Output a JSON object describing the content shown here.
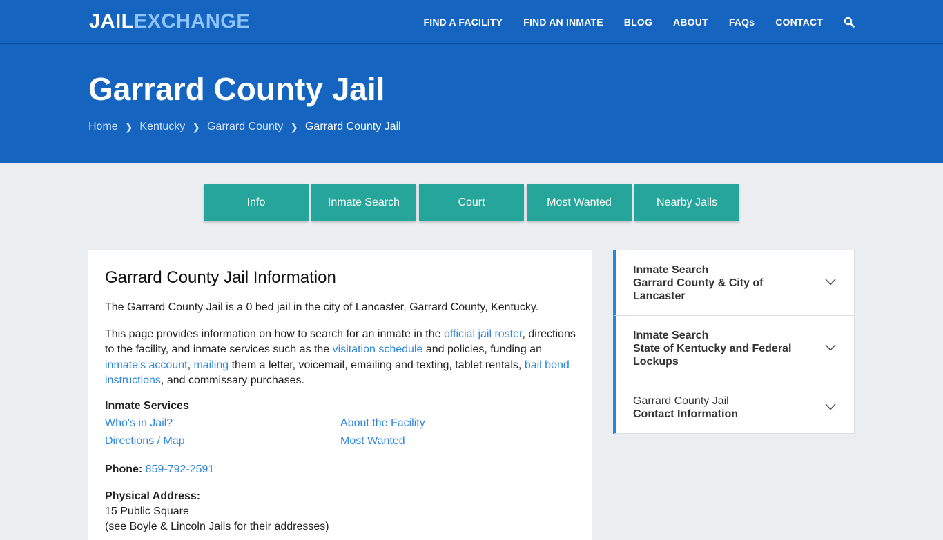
{
  "logo": {
    "part1": "JAIL",
    "part2": "EXCHANGE"
  },
  "nav": {
    "items": [
      "FIND A FACILITY",
      "FIND AN INMATE",
      "BLOG",
      "ABOUT",
      "FAQs",
      "CONTACT"
    ],
    "search_icon": "search-icon"
  },
  "hero": {
    "title": "Garrard County Jail",
    "breadcrumb": [
      "Home",
      "Kentucky",
      "Garrard County",
      "Garrard County Jail"
    ]
  },
  "tabs": [
    "Info",
    "Inmate Search",
    "Court",
    "Most Wanted",
    "Nearby Jails"
  ],
  "main": {
    "heading": "Garrard County Jail Information",
    "intro": "The Garrard County Jail is a 0 bed jail in the city of Lancaster, Garrard County, Kentucky.",
    "para2": {
      "t1": "This page provides information on how to search for an inmate in the ",
      "l1": "official jail roster",
      "t2": ", directions to the facility, and inmate services such as the ",
      "l2": "visitation schedule",
      "t3": " and policies, funding an ",
      "l3": "inmate's account",
      "t4": ", ",
      "l4": "mailing",
      "t5": " them a letter, voicemail, emailing and texting, tablet rentals, ",
      "l5": "bail bond instructions",
      "t6": ", and commissary purchases."
    },
    "services_title": "Inmate Services",
    "services": [
      "Who's in Jail?",
      "About the Facility",
      "Directions / Map",
      "Most Wanted"
    ],
    "phone_label": "Phone:",
    "phone": "859-792-2591",
    "address_label": "Physical Address:",
    "address_line1": "15 Public Square",
    "address_line2": "(see Boyle & Lincoln Jails for their addresses)"
  },
  "sidebar": [
    {
      "line1": "Inmate Search",
      "line2": "Garrard County & City of Lancaster"
    },
    {
      "line1": "Inmate Search",
      "line2": "State of Kentucky and Federal Lockups"
    },
    {
      "line1": "Garrard County Jail",
      "line2": "Contact Information"
    }
  ],
  "colors": {
    "header": "#1565c0",
    "tab": "#26a69a",
    "link": "#2e86de",
    "accent": "#1e88e5"
  }
}
